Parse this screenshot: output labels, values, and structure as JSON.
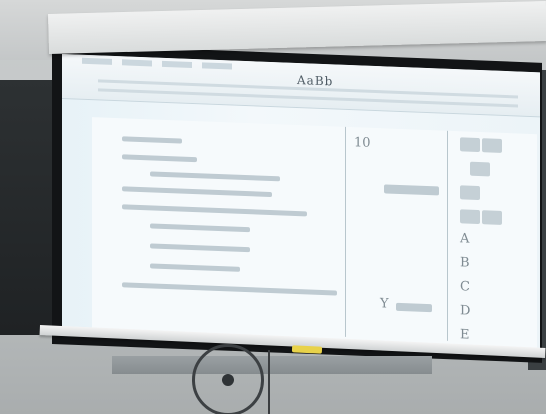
{
  "projected_document": {
    "style_sample": "AaBb",
    "middle_column_number": "10",
    "middle_column_label": "Y",
    "right_column_letters": [
      "A",
      "B",
      "C",
      "D",
      "E"
    ]
  }
}
